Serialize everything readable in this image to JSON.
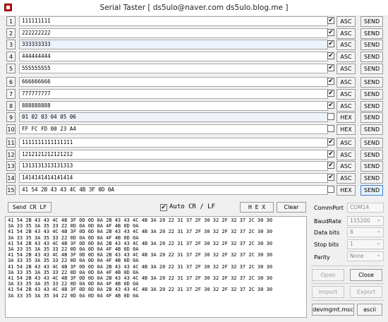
{
  "window": {
    "title": "Serial Taster   [ ds5ulo@naver.com  ds5ulo.blog.me ]"
  },
  "rows": [
    {
      "num": "1",
      "text": "111111111",
      "checked": true,
      "mode": "ASC",
      "send": "SEND"
    },
    {
      "num": "2",
      "text": "222222222",
      "checked": true,
      "mode": "ASC",
      "send": "SEND"
    },
    {
      "num": "3",
      "text": "333333333",
      "checked": true,
      "mode": "ASC",
      "send": "SEND"
    },
    {
      "num": "4",
      "text": "444444444",
      "checked": true,
      "mode": "ASC",
      "send": "SEND"
    },
    {
      "num": "5",
      "text": "555555555",
      "checked": true,
      "mode": "ASC",
      "send": "SEND"
    },
    {
      "num": "6",
      "text": "666666666",
      "checked": true,
      "mode": "ASC",
      "send": "SEND"
    },
    {
      "num": "7",
      "text": "777777777",
      "checked": true,
      "mode": "ASC",
      "send": "SEND"
    },
    {
      "num": "8",
      "text": "888888888",
      "checked": true,
      "mode": "ASC",
      "send": "SEND"
    },
    {
      "num": "9",
      "text": "01 02 03 04 05 06",
      "checked": false,
      "mode": "HEX",
      "send": "SEND"
    },
    {
      "num": "10",
      "text": "FF FC FD 00 23 A4",
      "checked": false,
      "mode": "HEX",
      "send": "SEND"
    },
    {
      "num": "11",
      "text": "1111111111111111",
      "checked": true,
      "mode": "ASC",
      "send": "SEND"
    },
    {
      "num": "12",
      "text": "1212121212121212",
      "checked": true,
      "mode": "ASC",
      "send": "SEND"
    },
    {
      "num": "13",
      "text": "1313131313131313",
      "checked": true,
      "mode": "ASC",
      "send": "SEND"
    },
    {
      "num": "14",
      "text": "1414141414141414",
      "checked": true,
      "mode": "ASC",
      "send": "SEND"
    },
    {
      "num": "15",
      "text": "41 54 2B 43 43 4C 4B 3F 0D 0A",
      "checked": false,
      "mode": "HEX",
      "send": "SEND"
    }
  ],
  "controls": {
    "send_crlf": "Send CR LF",
    "auto_crlf_checked": true,
    "auto_crlf": "Auto CR / LF",
    "hex": "H E X",
    "clear": "Clear"
  },
  "log_lines": [
    "41 54 2B 43 43 4C 4B 3F 0D 0D 0A 2B 43 43 4C 4B 3A 20 22 31 37 2F 30 32 2F 32 37 2C 30 30",
    "3A 33 35 3A 35 33 22 0D 0A 0D 0A 4F 4B 0D 0A",
    "41 54 2B 43 43 4C 4B 3F 0D 0D 0A 2B 43 43 4C 4B 3A 20 22 31 37 2F 30 32 2F 32 37 2C 30 30",
    "3A 33 35 3A 35 33 22 0D 0A 0D 0A 4F 4B 0D 0A",
    "41 54 2B 43 43 4C 4B 3F 0D 0D 0A 2B 43 43 4C 4B 3A 20 22 31 37 2F 30 32 2F 32 37 2C 30 30",
    "3A 33 35 3A 35 33 22 0D 0A 0D 0A 4F 4B 0D 0A",
    "41 54 2B 43 43 4C 4B 3F 0D 0D 0A 2B 43 43 4C 4B 3A 20 22 31 37 2F 30 32 2F 32 37 2C 30 30",
    "3A 33 35 3A 35 33 22 0D 0A 0D 0A 4F 4B 0D 0A",
    "41 54 2B 43 43 4C 4B 3F 0D 0D 0A 2B 43 43 4C 4B 3A 20 22 31 37 2F 30 32 2F 32 37 2C 30 30",
    "3A 33 35 3A 35 33 22 0D 0A 0D 0A 4F 4B 0D 0A",
    "41 54 2B 43 43 4C 4B 3F 0D 0D 0A 2B 43 43 4C 4B 3A 20 22 31 37 2F 30 32 2F 32 37 2C 30 30",
    "3A 33 35 3A 35 33 22 0D 0A 0D 0A 4F 4B 0D 0A",
    "41 54 2B 43 43 4C 4B 3F 0D 0D 0A 2B 43 43 4C 4B 3A 20 22 31 37 2F 30 32 2F 32 37 2C 30 30",
    "3A 33 35 3A 35 34 22 0D 0A 0D 0A 4F 4B 0D 0A"
  ],
  "settings": {
    "comm_port": {
      "label": "CommPort",
      "value": "COM14"
    },
    "baud_rate": {
      "label": "BaudRate",
      "value": "115200"
    },
    "data_bits": {
      "label": "Data bits",
      "value": "8"
    },
    "stop_bits": {
      "label": "Stop bits",
      "value": "1"
    },
    "parity": {
      "label": "Parity",
      "value": "None"
    }
  },
  "buttons": {
    "open": "Open",
    "close": "Close",
    "import": "Import",
    "export": "Export",
    "devmgmt": "devmgmt.msc",
    "ascii": "ascii"
  }
}
